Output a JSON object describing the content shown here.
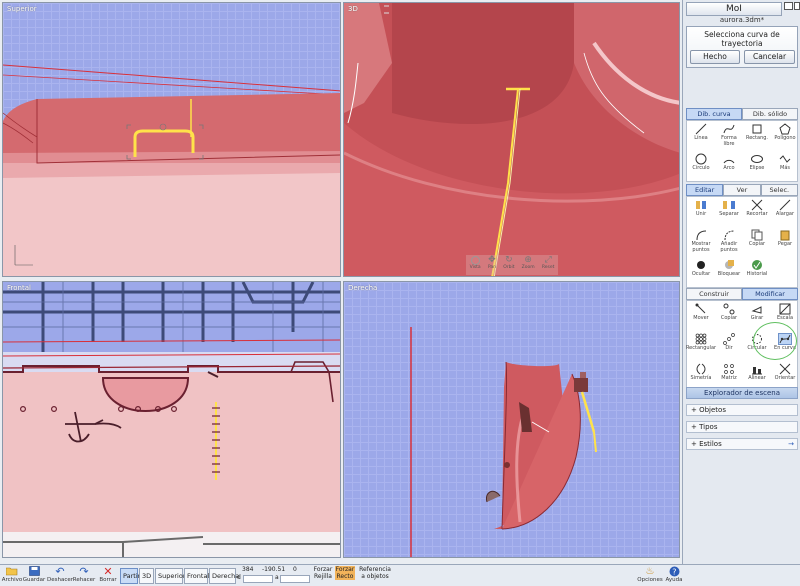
{
  "viewports": {
    "top_title": "Superior",
    "persp_title": "3D",
    "front_title": "Frontal",
    "right_title": "Derecha",
    "nav_labels": [
      "Vista",
      "Pan",
      "Orbit",
      "Zoom",
      "Reset"
    ]
  },
  "panel": {
    "app_name": "MoI",
    "file_name": "aurora.3dm*",
    "prompt": "Selecciona curva de trayectoria",
    "done_label": "Hecho",
    "cancel_label": "Cancelar",
    "draw_tabs": [
      "Dib. curva",
      "Dib. sólido"
    ],
    "draw_tools": [
      {
        "label": "Línea",
        "icon": "line-icon"
      },
      {
        "label": "Forma libre",
        "icon": "freeform-icon"
      },
      {
        "label": "Rectang.",
        "icon": "rectangle-icon"
      },
      {
        "label": "Polígono",
        "icon": "polygon-icon"
      },
      {
        "label": "Círculo",
        "icon": "circle-icon"
      },
      {
        "label": "Arco",
        "icon": "arc-icon"
      },
      {
        "label": "Elipse",
        "icon": "ellipse-icon"
      },
      {
        "label": "Más",
        "icon": "more-icon"
      }
    ],
    "edit_tabs": [
      "Editar",
      "Ver",
      "Selec."
    ],
    "edit_tools": [
      {
        "label": "Unir",
        "icon": "join-icon"
      },
      {
        "label": "Separar",
        "icon": "separate-icon"
      },
      {
        "label": "Recortar",
        "icon": "trim-icon"
      },
      {
        "label": "Alargar",
        "icon": "extend-icon"
      },
      {
        "label": "Mostrar puntos",
        "icon": "show-points-icon"
      },
      {
        "label": "Añadir puntos",
        "icon": "add-points-icon"
      },
      {
        "label": "Copiar",
        "icon": "copy-icon"
      },
      {
        "label": "Pegar",
        "icon": "paste-icon"
      },
      {
        "label": "Ocultar",
        "icon": "hide-icon"
      },
      {
        "label": "Bloquear",
        "icon": "lock-icon"
      },
      {
        "label": "Historial",
        "icon": "history-icon"
      }
    ],
    "build_tabs": [
      "Construir",
      "Modificar"
    ],
    "build_tools": [
      {
        "label": "Mover",
        "icon": "move-icon"
      },
      {
        "label": "Copiar",
        "icon": "copy-icon"
      },
      {
        "label": "Girar",
        "icon": "rotate-icon"
      },
      {
        "label": "Escala",
        "icon": "scale-icon"
      },
      {
        "label": "Rectangular",
        "icon": "rect-array-icon"
      },
      {
        "label": "Dir",
        "icon": "dir-array-icon"
      },
      {
        "label": "Circular",
        "icon": "circular-array-icon"
      },
      {
        "label": "En curva",
        "icon": "curve-array-icon"
      },
      {
        "label": "Simetría",
        "icon": "mirror-icon"
      },
      {
        "label": "Matriz",
        "icon": "matrix-icon"
      },
      {
        "label": "Alinear",
        "icon": "align-icon"
      },
      {
        "label": "Orientar",
        "icon": "orient-icon"
      }
    ],
    "explorer_title": "Explorador de escena",
    "explorer_items": [
      "Objetos",
      "Tipos",
      "Estilos"
    ]
  },
  "bottom": {
    "file_items": [
      "Archivo",
      "Guardar"
    ],
    "undo_items": [
      "Deshacer",
      "Rehacer"
    ],
    "delete_label": "Borrar",
    "view_buttons": [
      "Partir",
      "3D",
      "Superior",
      "Frontal",
      "Derecha"
    ],
    "coord_x": "384",
    "coord_y": "-190.51",
    "coord_z": "0",
    "coord_d_label": "d",
    "coord_a_label": "a",
    "snap_items": [
      "Forzar Rejilla",
      "Forzar Recto",
      "Referencia a objetos"
    ],
    "options_label": "Opciones",
    "help_label": "Ayuda"
  },
  "colors": {
    "hull": "#d65a5f",
    "hull_dark": "#b6434a",
    "grid_blue": "#9ca8e9",
    "highlight": "#ffe24a",
    "accent_green": "#5fbf5f"
  }
}
